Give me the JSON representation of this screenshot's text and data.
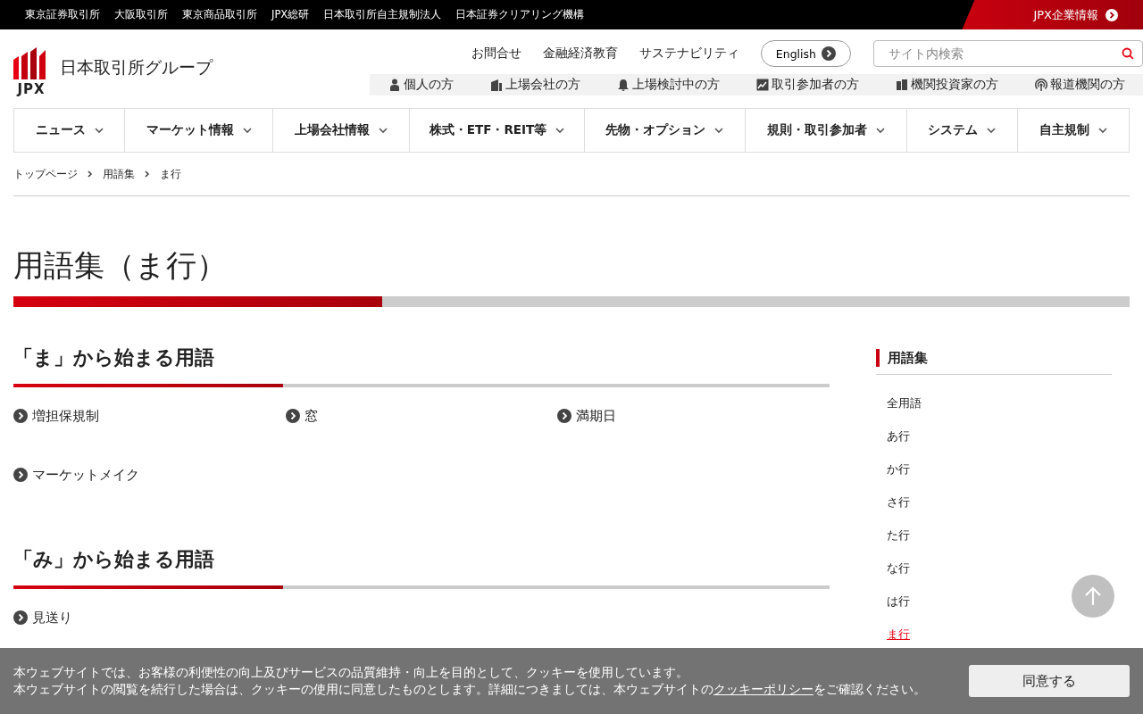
{
  "top_bar": {
    "links": [
      "東京証券取引所",
      "大阪取引所",
      "東京商品取引所",
      "JPX総研",
      "日本取引所自主規制法人",
      "日本証券クリアリング機構"
    ],
    "corporate_link": "JPX企業情報"
  },
  "header": {
    "logo_mark": "JPX",
    "logo_text": "日本取引所グループ",
    "utility_links": [
      "お問合せ",
      "金融経済教育",
      "サステナビリティ"
    ],
    "language_button": "English",
    "search": {
      "placeholder": "サイト内検索"
    },
    "audience_links": [
      {
        "label": "個人の方",
        "kind": "person"
      },
      {
        "label": "上場会社の方",
        "kind": "building"
      },
      {
        "label": "上場検討中の方",
        "kind": "bell"
      },
      {
        "label": "取引参加者の方",
        "kind": "chart"
      },
      {
        "label": "機関投資家の方",
        "kind": "devices"
      },
      {
        "label": "報道機関の方",
        "kind": "broadcast"
      }
    ]
  },
  "nav": [
    "ニュース",
    "マーケット情報",
    "上場会社情報",
    "株式・ETF・REIT等",
    "先物・オプション",
    "規則・取引参加者",
    "システム",
    "自主規制"
  ],
  "breadcrumb": [
    "トップページ",
    "用語集",
    "ま行"
  ],
  "page_title": "用語集（ま行）",
  "sections": [
    {
      "heading": "「ま」から始まる用語",
      "terms": [
        "増担保規制",
        "窓",
        "満期日",
        "マーケットメイク"
      ]
    },
    {
      "heading": "「み」から始まる用語",
      "terms": [
        "見送り"
      ]
    }
  ],
  "sidebar": {
    "title": "用語集",
    "items": [
      {
        "label": "全用語",
        "selected": false
      },
      {
        "label": "あ行",
        "selected": false
      },
      {
        "label": "か行",
        "selected": false
      },
      {
        "label": "さ行",
        "selected": false
      },
      {
        "label": "た行",
        "selected": false
      },
      {
        "label": "な行",
        "selected": false
      },
      {
        "label": "は行",
        "selected": false
      },
      {
        "label": "ま行",
        "selected": true
      }
    ]
  },
  "cookie_banner": {
    "text_first": "本ウェブサイトでは、お客様の利便性の向上及びサービスの品質維持・向上を目的として、クッキーを使用しています。",
    "text_before": "本ウェブサイトの閲覧を続行した場合は、クッキーの使用に同意したものとします。詳細につきましては、本ウェブサイトの",
    "link": "クッキーポリシー",
    "text_after": "をご確認ください。",
    "button": "同意する"
  }
}
